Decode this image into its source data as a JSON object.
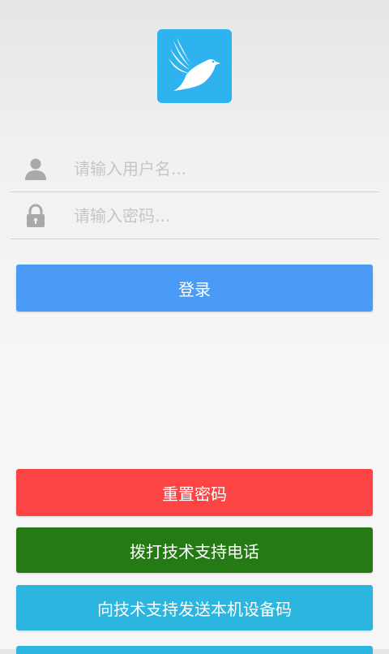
{
  "logo": {
    "icon": "dove-icon",
    "color": "#2fb3ee"
  },
  "username": {
    "icon": "user-icon",
    "placeholder": "请输入用户名...",
    "value": ""
  },
  "password": {
    "icon": "lock-icon",
    "placeholder": "请输入密码...",
    "value": ""
  },
  "buttons": {
    "login": {
      "label": "登录",
      "color": "#4a9bf5"
    },
    "reset_password": {
      "label": "重置密码",
      "color": "#fc4445"
    },
    "call_support": {
      "label": "拨打技术支持电话",
      "color": "#267a15"
    },
    "send_device_code": {
      "label": "向技术支持发送本机设备码",
      "color": "#2cb5df"
    }
  }
}
